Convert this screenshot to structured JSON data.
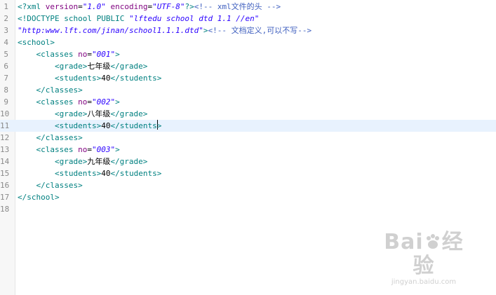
{
  "editor": {
    "line_numbers": [
      "1",
      "2",
      "3",
      "4",
      "5",
      "6",
      "7",
      "8",
      "9",
      "10",
      "11",
      "12",
      "13",
      "14",
      "15",
      "16",
      "17",
      "18"
    ],
    "lines": {
      "l1": {
        "a": "<?xml ",
        "b": "version",
        "c": "=",
        "d": "\"1.0\"",
        "e": " ",
        "f": "encoding",
        "g": "=",
        "h": "\"UTF-8\"",
        "i": "?>",
        "j": "<!-- xml文件的头 -->"
      },
      "l2": {
        "a": "<!DOCTYPE school PUBLIC ",
        "b": "\"lftedu school dtd 1.1 //en\""
      },
      "l3": {
        "a": "\"http:www.lft.com/jinan/school1.1.1.dtd\"",
        "b": ">",
        "c": "<!-- 文档定义,可以不写-->"
      },
      "l4": {
        "a": "<school>"
      },
      "l5": {
        "a": "    <classes ",
        "b": "no",
        "c": "=",
        "d": "\"001\"",
        "e": ">"
      },
      "l6": {
        "a": "        <grade>",
        "b": "七年级",
        "c": "</grade>"
      },
      "l7": {
        "a": "        <students>",
        "b": "40",
        "c": "</students>"
      },
      "l8": {
        "a": "    </classes>"
      },
      "l9": {
        "a": "    <classes ",
        "b": "no",
        "c": "=",
        "d": "\"002\"",
        "e": ">"
      },
      "l10": {
        "a": "        <grade>",
        "b": "八年级",
        "c": "</grade>"
      },
      "l11": {
        "a": "        <students>",
        "b": "40",
        "c": "</students",
        "d": ">"
      },
      "l12": {
        "a": "    </classes>"
      },
      "l13": {
        "a": "    <classes ",
        "b": "no",
        "c": "=",
        "d": "\"003\"",
        "e": ">"
      },
      "l14": {
        "a": "        <grade>",
        "b": "九年级",
        "c": "</grade>"
      },
      "l15": {
        "a": "        <students>",
        "b": "40",
        "c": "</students>"
      },
      "l16": {
        "a": "    </classes>"
      },
      "l17": {
        "a": "</school>"
      },
      "l18": {
        "a": ""
      }
    }
  },
  "watermark": {
    "logo_left": "Bai",
    "logo_right": "经验",
    "url": "jingyan.baidu.com"
  },
  "colors": {
    "tag": "#008080",
    "string": "#2a00ff",
    "attribute": "#7f007f",
    "comment": "#3f5fbf",
    "current_line": "#e8f2fe"
  }
}
